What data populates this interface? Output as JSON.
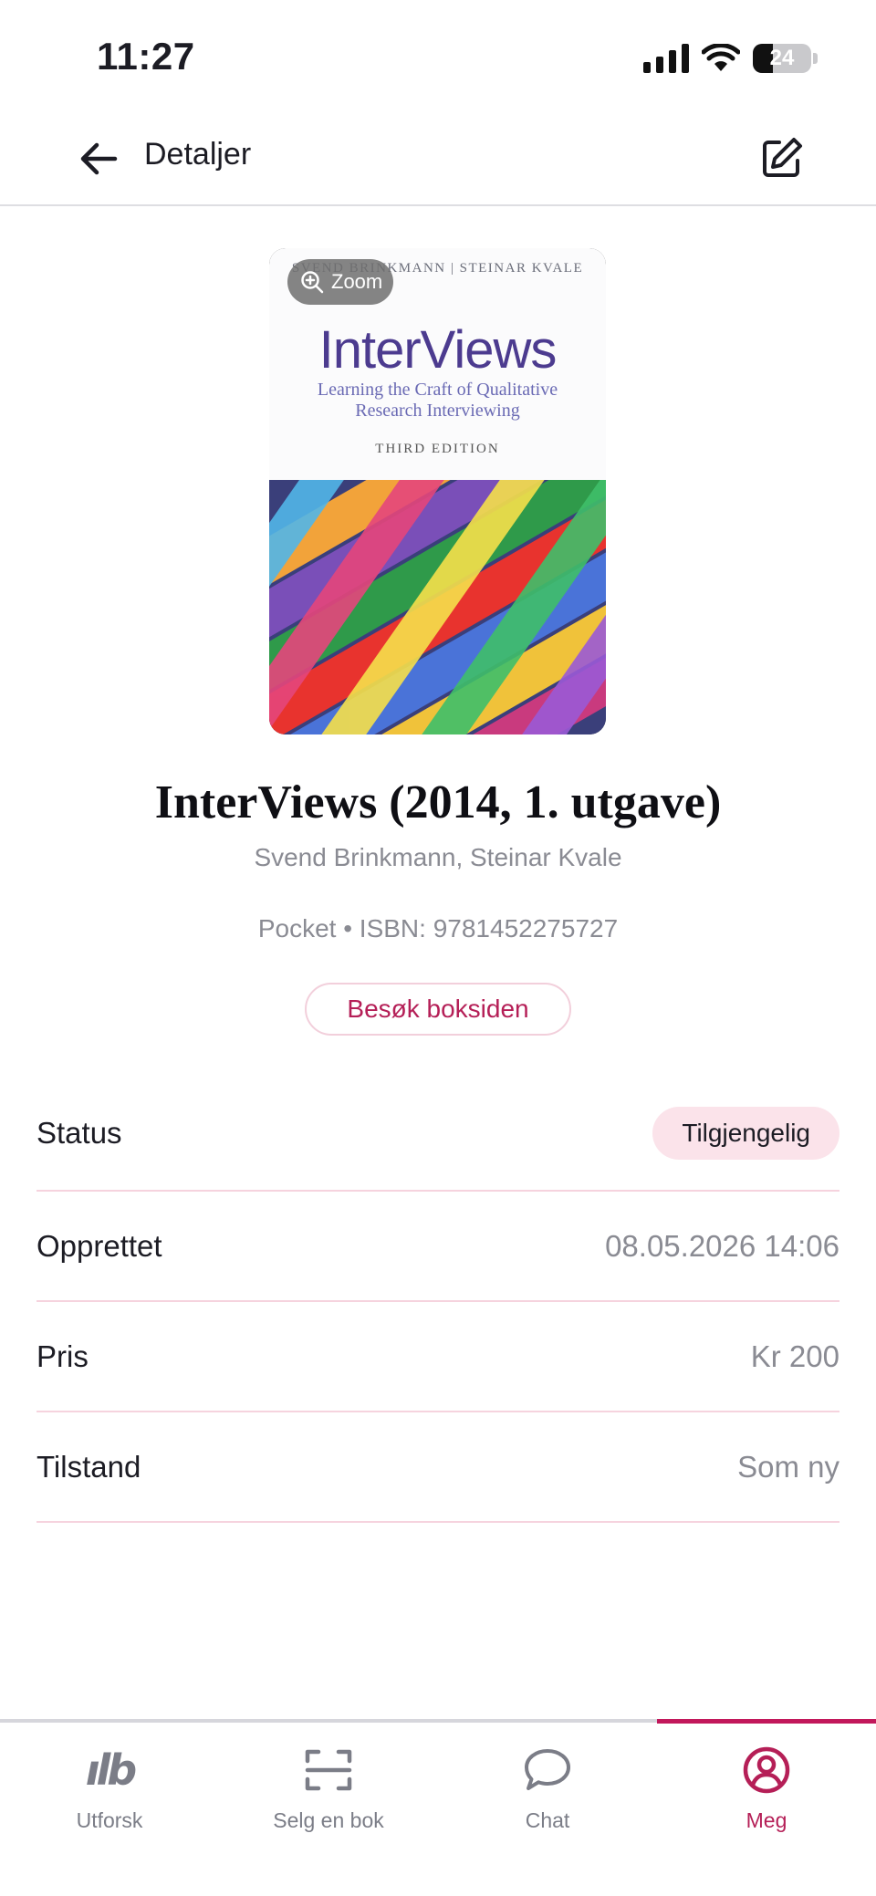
{
  "status_bar": {
    "time": "11:27",
    "battery": "24"
  },
  "header": {
    "title": "Detaljer"
  },
  "cover": {
    "authors": "SVEND BRINKMANN  |  STEINAR KVALE",
    "title": "InterViews",
    "subtitle": "Learning the Craft of Qualitative Research Interviewing",
    "edition": "THIRD EDITION",
    "zoom_label": "Zoom"
  },
  "book": {
    "title": "InterViews (2014, 1. utgave)",
    "authors": "Svend Brinkmann, Steinar Kvale",
    "meta": "Pocket • ISBN: 9781452275727",
    "visit_label": "Besøk boksiden"
  },
  "details": {
    "status_label": "Status",
    "status_value": "Tilgjengelig",
    "created_label": "Opprettet",
    "created_value": "08.05.2026 14:06",
    "price_label": "Pris",
    "price_value": "Kr 200",
    "condition_label": "Tilstand",
    "condition_value": "Som ny"
  },
  "nav": {
    "items": [
      {
        "label": "Utforsk",
        "icon": "logo-icon"
      },
      {
        "label": "Selg en bok",
        "icon": "scan-icon"
      },
      {
        "label": "Chat",
        "icon": "chat-icon"
      },
      {
        "label": "Meg",
        "icon": "profile-icon"
      }
    ],
    "active": "Meg",
    "accent": "#b51f57"
  }
}
